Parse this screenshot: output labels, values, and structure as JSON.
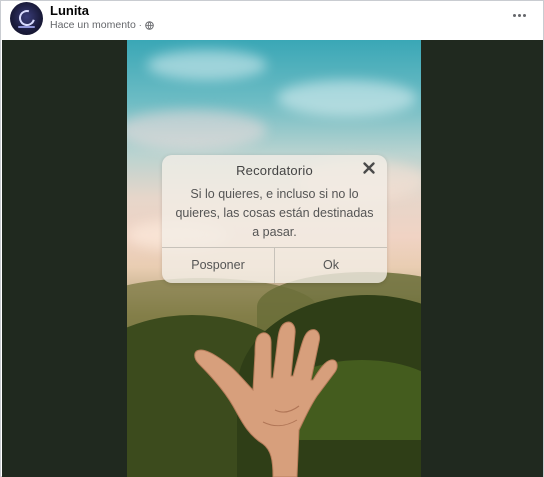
{
  "post": {
    "author": "Lunita",
    "timestamp": "Hace un momento",
    "separator": "·",
    "privacy_icon": "globe-icon",
    "more_icon": "more-options-icon"
  },
  "dialog": {
    "title": "Recordatorio",
    "message": "Si lo quieres, e incluso si no lo quieres, las cosas están destinadas a pasar.",
    "buttons": {
      "postpone": "Posponer",
      "ok": "Ok"
    },
    "close_icon": "close-icon"
  },
  "colors": {
    "media_background": "#20291f",
    "dialog_background": "#f3eee6",
    "meta_text": "#65676b"
  }
}
